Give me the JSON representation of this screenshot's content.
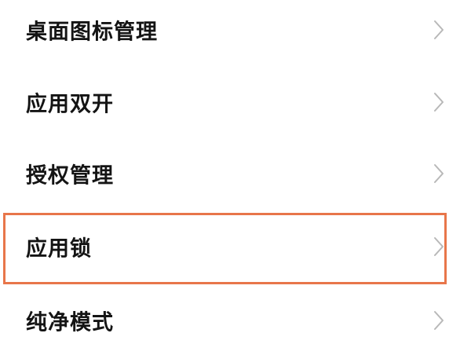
{
  "settings": {
    "items": [
      {
        "label": "桌面图标管理",
        "icon": "chevron-right-icon"
      },
      {
        "label": "应用双开",
        "icon": "chevron-right-icon"
      },
      {
        "label": "授权管理",
        "icon": "chevron-right-icon"
      },
      {
        "label": "应用锁",
        "icon": "chevron-right-icon",
        "highlighted": true
      },
      {
        "label": "纯净模式",
        "icon": "chevron-right-icon"
      }
    ]
  },
  "colors": {
    "background": "#ffffff",
    "label_text": "#141414",
    "chevron": "#b8b8b8",
    "highlight_border": "#E8764A"
  }
}
